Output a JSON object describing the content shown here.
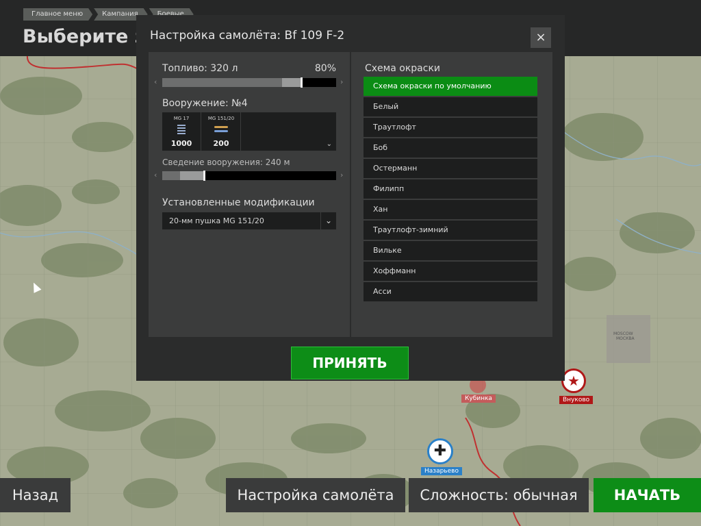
{
  "breadcrumbs": [
    "Главное меню",
    "Кампания",
    "Боевые"
  ],
  "page_title": "Выберите за",
  "modal": {
    "title": "Настройка самолёта: Bf 109 F-2",
    "close_label": "×",
    "fuel": {
      "label": "Топливо: 320 л",
      "percent_label": "80%",
      "value": 0.8
    },
    "armament": {
      "label": "Вооружение: №4",
      "weapons": [
        {
          "name": "MG 17",
          "count": "1000"
        },
        {
          "name": "MG 151/20",
          "count": "200"
        }
      ]
    },
    "convergence": {
      "label": "Сведение вооружения: 240 м",
      "value": 0.24
    },
    "mods": {
      "label": "Установленные модификации",
      "value": "20-мм пушка MG 151/20"
    },
    "skins": {
      "label": "Схема окраски",
      "items": [
        "Схема окраски по умолчанию",
        "Белый",
        "Траутлофт",
        "Боб",
        "Остерманн",
        "Филипп",
        "Хан",
        "Траутлофт-зимний",
        "Вильке",
        "Хоффманн",
        "Асси"
      ],
      "selected_index": 0
    },
    "accept_label": "ПРИНЯТЬ"
  },
  "map_labels": {
    "kubinka": "Кубинка",
    "vnukovo": "Внуково",
    "nazarevo": "Назарьево",
    "moscow": "MOSCOW",
    "moscow_ru": "МОСКВА"
  },
  "bottom": {
    "back_label": "Назад",
    "setup_label": "Настройка самолёта",
    "difficulty_label": "Сложность: обычная",
    "start_label": "НАЧАТЬ"
  },
  "colors": {
    "accent_green": "#0d8d17",
    "panel": "#3b3c3c",
    "dark": "#1d1e1e",
    "river": "#8fb0c6",
    "front_line": "#c03030"
  }
}
